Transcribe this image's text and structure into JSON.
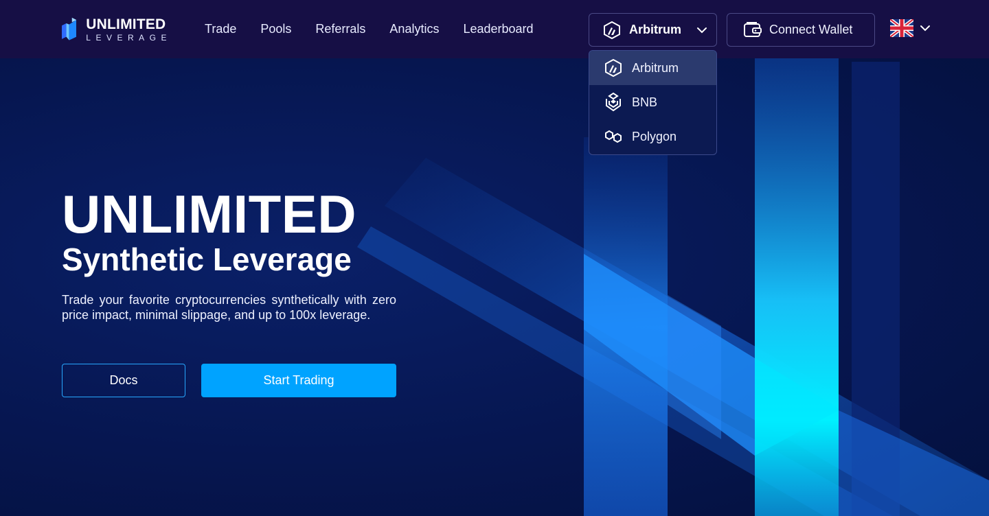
{
  "brand": {
    "name_top": "UNLIMITED",
    "name_bottom": "LEVERAGE"
  },
  "nav": {
    "items": [
      {
        "label": "Trade"
      },
      {
        "label": "Pools"
      },
      {
        "label": "Referrals"
      },
      {
        "label": "Analytics"
      },
      {
        "label": "Leaderboard"
      }
    ]
  },
  "network": {
    "selected": "Arbitrum",
    "icon": "arbitrum-icon",
    "options": [
      {
        "label": "Arbitrum",
        "icon": "arbitrum-icon",
        "active": true
      },
      {
        "label": "BNB",
        "icon": "bnb-icon",
        "active": false
      },
      {
        "label": "Polygon",
        "icon": "polygon-icon",
        "active": false
      }
    ]
  },
  "wallet": {
    "label": "Connect Wallet",
    "icon": "wallet-icon"
  },
  "language": {
    "icon": "uk-flag-icon"
  },
  "hero": {
    "title": "UNLIMITED",
    "subtitle": "Synthetic Leverage",
    "description": "Trade your favorite cryptocurrencies synthetically with zero price impact, minimal slippage, and up to 100x leverage.",
    "docs_label": "Docs",
    "start_label": "Start Trading"
  },
  "colors": {
    "header_bg": "#160f45",
    "page_bg": "#06164a",
    "accent": "#00a3ff",
    "docs_border": "#27a8ff",
    "beam_cyan": "#00e5ff"
  }
}
